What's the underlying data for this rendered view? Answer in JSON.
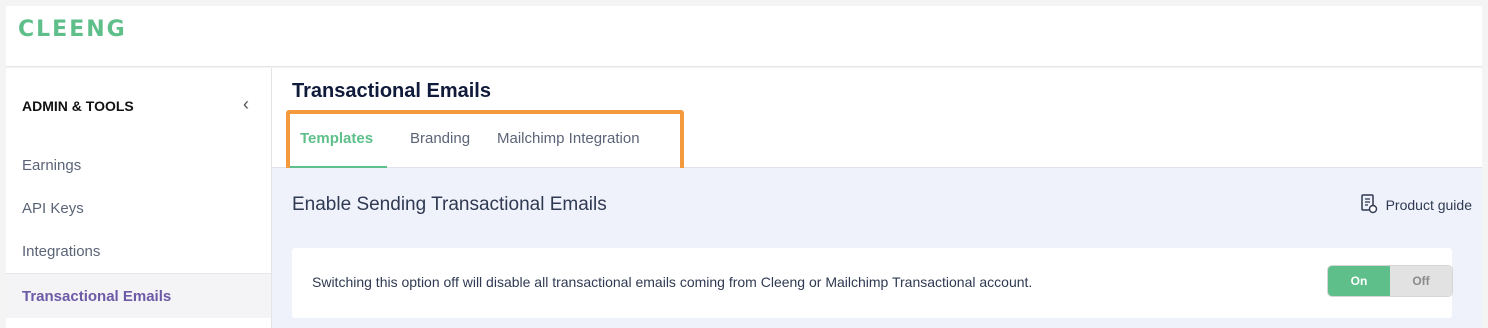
{
  "brand": {
    "logo_text": "CLEENG",
    "accent_color": "#5fbf8a"
  },
  "sidebar": {
    "title": "ADMIN & TOOLS",
    "collapse_icon": "chevron-left-icon",
    "items": [
      {
        "label": "Earnings",
        "active": false
      },
      {
        "label": "API Keys",
        "active": false
      },
      {
        "label": "Integrations",
        "active": false
      },
      {
        "label": "Transactional Emails",
        "active": true
      }
    ]
  },
  "main": {
    "title": "Transactional Emails",
    "tabs": [
      {
        "label": "Templates",
        "active": true
      },
      {
        "label": "Branding",
        "active": false
      },
      {
        "label": "Mailchimp Integration",
        "active": false
      }
    ],
    "highlight_color": "#f39a3e",
    "section_title": "Enable Sending Transactional Emails",
    "product_guide": {
      "label": "Product guide",
      "icon": "document-guide-icon"
    },
    "setting": {
      "description": "Switching this option off will disable all transactional emails coming from Cleeng or Mailchimp Transactional account.",
      "toggle": {
        "on_label": "On",
        "off_label": "Off",
        "selected": "On"
      }
    }
  }
}
